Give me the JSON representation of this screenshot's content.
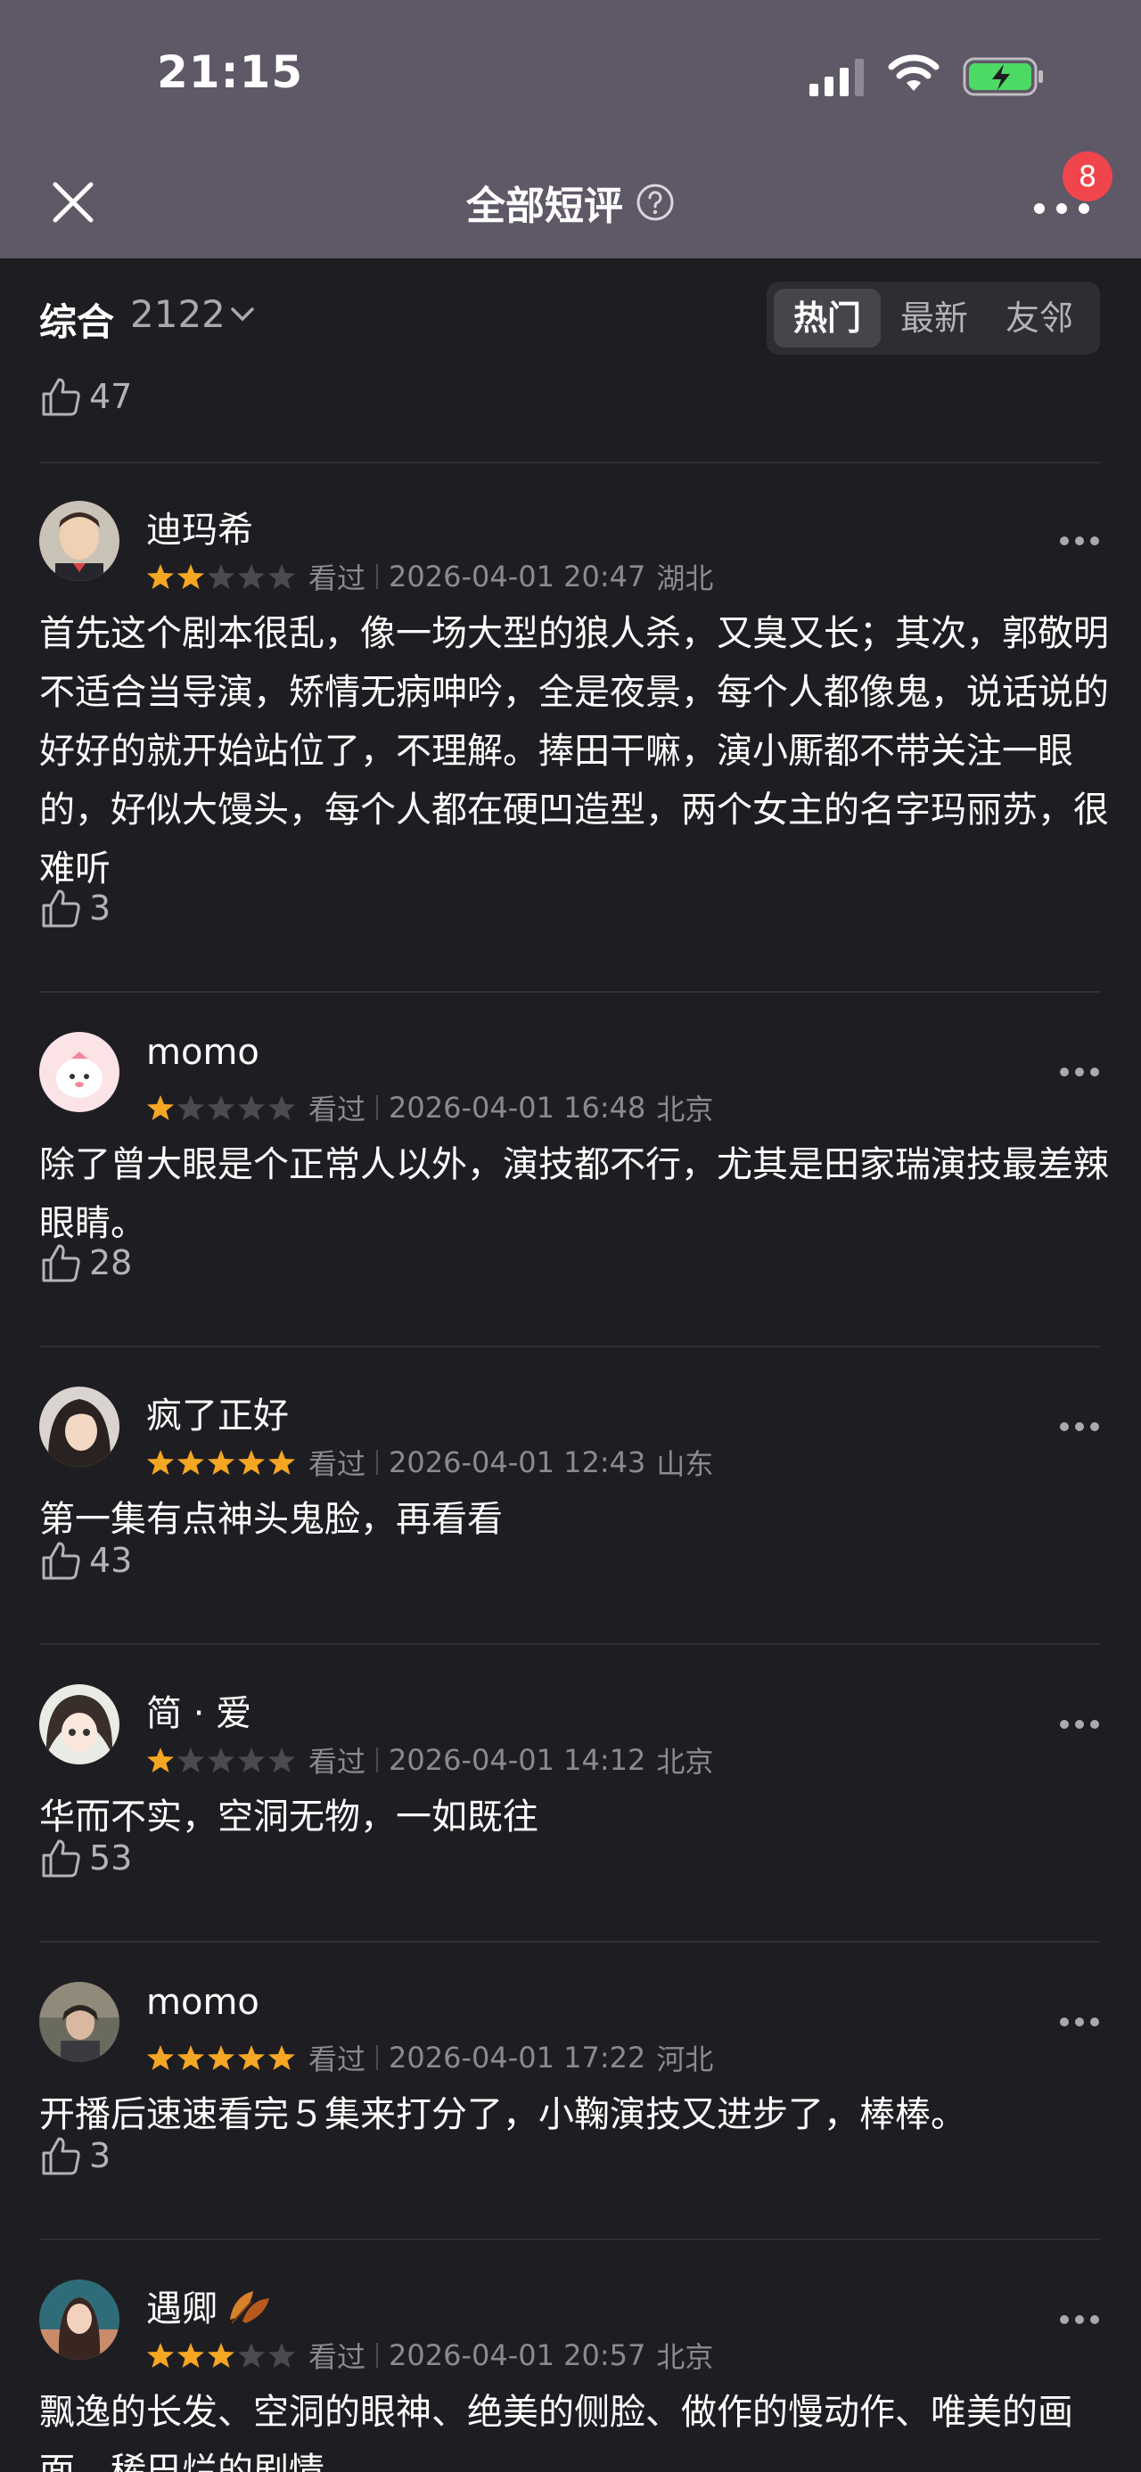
{
  "status_bar": {
    "time": "21:15"
  },
  "nav": {
    "title": "全部短评",
    "notification_count": "8"
  },
  "filter": {
    "sort_label": "综合",
    "count": "2122",
    "tabs": [
      "热门",
      "最新",
      "友邻"
    ],
    "active_tab": "热门"
  },
  "top_like_count": "47",
  "reviews": [
    {
      "username": "迪玛希",
      "stars": 2,
      "status": "看过",
      "date": "2026-04-01 20:47",
      "location": "湖北",
      "content": "首先这个剧本很乱，像一场大型的狼人杀，又臭又长；其次，郭敬明不适合当导演，矫情无病呻吟，全是夜景，每个人都像鬼，说话说的好好的就开始站位了，不理解。捧田干嘛，演小厮都不带关注一眼的，好似大馒头，每个人都在硬凹造型，两个女主的名字玛丽苏，很难听",
      "likes": "3"
    },
    {
      "username": "momo",
      "stars": 1,
      "status": "看过",
      "date": "2026-04-01 16:48",
      "location": "北京",
      "content": "除了曾大眼是个正常人以外，演技都不行，尤其是田家瑞演技最差辣眼睛。",
      "likes": "28"
    },
    {
      "username": "疯了正好",
      "stars": 5,
      "status": "看过",
      "date": "2026-04-01 12:43",
      "location": "山东",
      "content": "第一集有点神头鬼脸，再看看",
      "likes": "43"
    },
    {
      "username": "简 · 爱",
      "stars": 1,
      "status": "看过",
      "date": "2026-04-01 14:12",
      "location": "北京",
      "content": "华而不实，空洞无物，一如既往",
      "likes": "53"
    },
    {
      "username": "momo",
      "stars": 5,
      "status": "看过",
      "date": "2026-04-01 17:22",
      "location": "河北",
      "content": "开播后速速看完５集来打分了，小鞠演技又进步了，棒棒。",
      "likes": "3"
    },
    {
      "username": "遇卿",
      "stars": 3,
      "status": "看过",
      "date": "2026-04-01 20:57",
      "location": "北京",
      "content": "飘逸的长发、空洞的眼神、绝美的侧脸、做作的慢动作、唯美的画面、稀巴烂的剧情",
      "likes": ""
    }
  ],
  "colors": {
    "header_bg": "#5f5867",
    "page_bg": "#1e1e22",
    "star": "#f5a623",
    "badge": "#f1454d"
  }
}
